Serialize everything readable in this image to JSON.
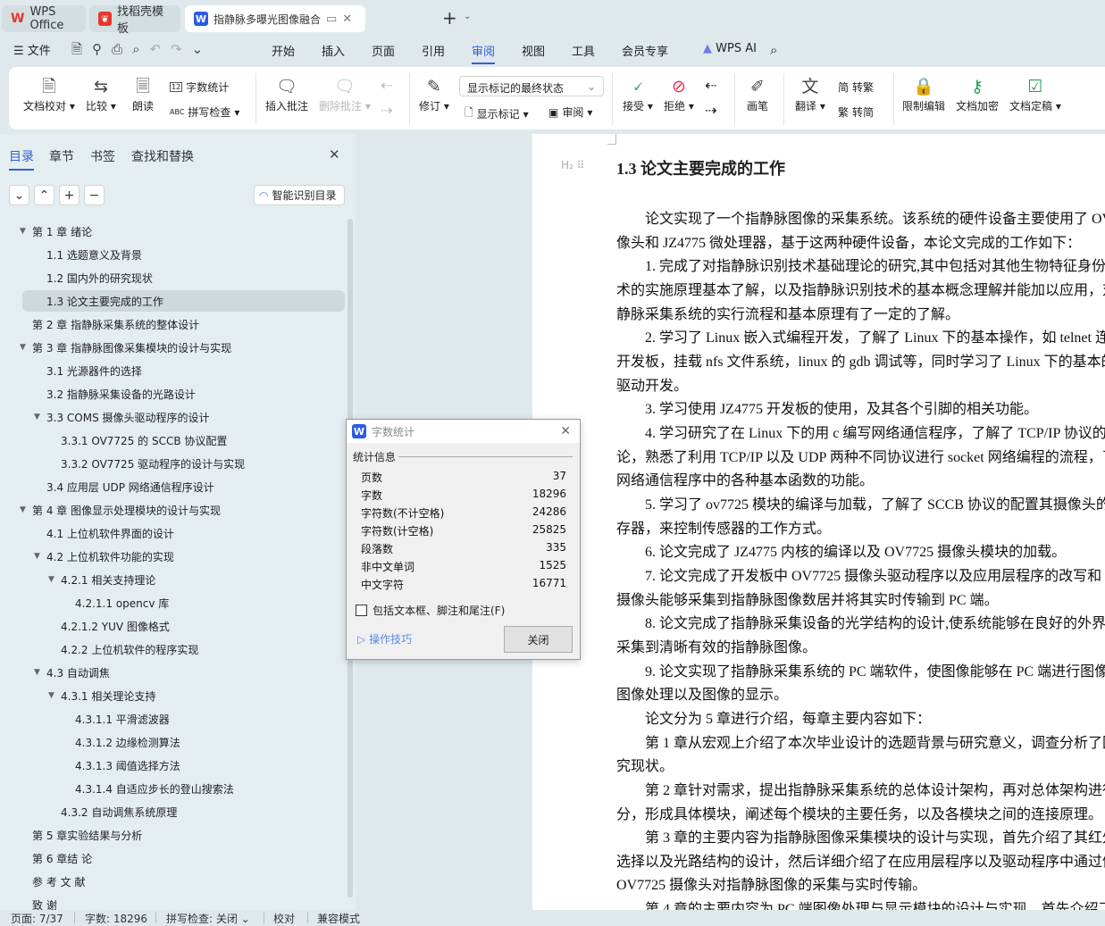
{
  "tabs": [
    {
      "label": "WPS Office",
      "icon": "wps-logo-icon"
    },
    {
      "label": "找稻壳模板",
      "icon": "docer-logo-icon"
    },
    {
      "label": "指静脉多曝光图像融合采集设计",
      "icon": "writer-logo-icon"
    }
  ],
  "menu": {
    "file": "文件",
    "items": [
      "开始",
      "插入",
      "页面",
      "引用",
      "审阅",
      "视图",
      "工具",
      "会员专享"
    ],
    "active": "审阅",
    "ai": "WPS AI"
  },
  "ribbon": {
    "proofread": "文档校对",
    "compare": "比较",
    "read_aloud": "朗读",
    "word_count": "字数统计",
    "spell_check": "拼写检查",
    "insert_comment": "插入批注",
    "delete_comment": "删除批注",
    "revise": "修订",
    "markup_select": "显示标记的最终状态",
    "show_markup": "显示标记",
    "review": "审阅",
    "accept": "接受",
    "reject": "拒绝",
    "pen": "画笔",
    "translate": "翻译",
    "to_traditional": "转繁",
    "to_simplified": "转简",
    "restrict_edit": "限制编辑",
    "encrypt": "文档加密",
    "finalize": "文档定稿"
  },
  "sidebar": {
    "tabs": [
      "目录",
      "章节",
      "书签",
      "查找和替换"
    ],
    "smart_toc": "智能识别目录",
    "outline": [
      {
        "label": "第 1 章  绪论",
        "level": 0,
        "expanded": true
      },
      {
        "label": "1.1  选题意义及背景",
        "level": 1
      },
      {
        "label": "1.2  国内外的研究现状",
        "level": 1
      },
      {
        "label": "1.3  论文主要完成的工作",
        "level": 1,
        "selected": true
      },
      {
        "label": "第 2 章  指静脉采集系统的整体设计",
        "level": 0
      },
      {
        "label": "第 3 章  指静脉图像采集模块的设计与实现",
        "level": 0,
        "expanded": true
      },
      {
        "label": "3.1  光源器件的选择",
        "level": 1
      },
      {
        "label": "3.2  指静脉采集设备的光路设计",
        "level": 1
      },
      {
        "label": "3.3 COMS 摄像头驱动程序的设计",
        "level": 1,
        "expanded": true
      },
      {
        "label": "3.3.1 OV7725 的 SCCB 协议配置",
        "level": 2
      },
      {
        "label": "3.3.2 OV7725 驱动程序的设计与实现",
        "level": 2
      },
      {
        "label": "3.4  应用层 UDP 网络通信程序设计",
        "level": 1
      },
      {
        "label": "第 4 章  图像显示处理模块的设计与实现",
        "level": 0,
        "expanded": true
      },
      {
        "label": "4.1  上位机软件界面的设计",
        "level": 1
      },
      {
        "label": "4.2  上位机软件功能的实现",
        "level": 1,
        "expanded": true
      },
      {
        "label": "4.2.1  相关支持理论",
        "level": 2,
        "expanded": true
      },
      {
        "label": "4.2.1.1  opencv 库",
        "level": 3
      },
      {
        "label": "4.2.1.2 YUV 图像格式",
        "level": 2
      },
      {
        "label": "4.2.2  上位机软件的程序实现",
        "level": 2
      },
      {
        "label": "4.3  自动调焦",
        "level": 1,
        "expanded": true
      },
      {
        "label": "4.3.1  相关理论支持",
        "level": 2,
        "expanded": true
      },
      {
        "label": "4.3.1.1  平滑滤波器",
        "level": 3
      },
      {
        "label": "4.3.1.2  边缘检测算法",
        "level": 3
      },
      {
        "label": "4.3.1.3  阈值选择方法",
        "level": 3
      },
      {
        "label": "4.3.1.4  自适应步长的登山搜索法",
        "level": 3
      },
      {
        "label": "4.3.2 自动调焦系统原理",
        "level": 2
      },
      {
        "label": "第 5 章实验结果与分析",
        "level": 0
      },
      {
        "label": "第 6 章结 论",
        "level": 0
      },
      {
        "label": "参 考 文 献",
        "level": 0
      },
      {
        "label": "致  谢",
        "level": 0
      }
    ]
  },
  "document": {
    "heading_marker": "H₂",
    "heading": "1.3  论文主要完成的工作",
    "lines": [
      {
        "t": "论文实现了一个指静脉图像的采集系统。该系统的硬件设备主要使用了 OV",
        "i": true
      },
      {
        "t": "像头和 JZ4775 微处理器，基于这两种硬件设备，本论文完成的工作如下："
      },
      {
        "t": "1. 完成了对指静脉识别技术基础理论的研究,其中包括对其他生物特征身份",
        "i": true
      },
      {
        "t": "术的实施原理基本了解，以及指静脉识别技术的基本概念理解并能加以应用，对"
      },
      {
        "t": "静脉采集系统的实行流程和基本原理有了一定的了解。"
      },
      {
        "t": "2. 学习了 Linux 嵌入式编程开发，了解了 Linux 下的基本操作，如 telnet 连",
        "i": true
      },
      {
        "t": "开发板，挂载 nfs 文件系统，linux 的 gdb 调试等，同时学习了 Linux 下的基本的"
      },
      {
        "t": "驱动开发。"
      },
      {
        "t": "3. 学习使用 JZ4775 开发板的使用，及其各个引脚的相关功能。",
        "i": true
      },
      {
        "t": "4. 学习研究了在 Linux 下的用 c 编写网络通信程序，了解了 TCP/IP 协议的",
        "i": true
      },
      {
        "t": "论，熟悉了利用 TCP/IP 以及 UDP 两种不同协议进行 socket 网络编程的流程，了"
      },
      {
        "t": "网络通信程序中的各种基本函数的功能。"
      },
      {
        "t": "5. 学习了 ov7725 模块的编译与加载，了解了 SCCB 协议的配置其摄像头的",
        "i": true
      },
      {
        "t": "存器，来控制传感器的工作方式。"
      },
      {
        "t": "6. 论文完成了 JZ4775 内核的编译以及 OV7725 摄像头模块的加载。",
        "i": true
      },
      {
        "t": "7. 论文完成了开发板中 OV7725 摄像头驱动程序以及应用层程序的改写和",
        "i": true
      },
      {
        "t": "摄像头能够采集到指静脉图像数居并将其实时传输到 PC 端。"
      },
      {
        "t": "8. 论文完成了指静脉采集设备的光学结构的设计,使系统能够在良好的外界",
        "i": true
      },
      {
        "t": "采集到清晰有效的指静脉图像。"
      },
      {
        "t": "9. 论文实现了指静脉采集系统的 PC 端软件，使图像能够在 PC 端进行图像",
        "i": true
      },
      {
        "t": "图像处理以及图像的显示。"
      },
      {
        "t": "论文分为 5 章进行介绍，每章主要内容如下：",
        "i": true
      },
      {
        "t": "第 1 章从宏观上介绍了本次毕业设计的选题背景与研究意义，调查分析了国",
        "i": true
      },
      {
        "t": "究现状。"
      },
      {
        "t": "第 2 章针对需求，提出指静脉采集系统的总体设计架构，再对总体架构进行",
        "i": true
      },
      {
        "t": "分，形成具体模块，阐述每个模块的主要任务，以及各模块之间的连接原理。"
      },
      {
        "t": "第 3 章的主要内容为指静脉图像采集模块的设计与实现，首先介绍了其红外",
        "i": true
      },
      {
        "t": "选择以及光路结构的设计，然后详细介绍了在应用层程序以及驱动程序中通过修"
      },
      {
        "t": "OV7725 摄像头对指静脉图像的采集与实时传输。"
      },
      {
        "t": "第 4 章的主要内容为 PC 端图像处理与显示模块的设计与实现，首先介绍了",
        "i": true
      }
    ]
  },
  "dialog": {
    "title": "字数统计",
    "section": "统计信息",
    "rows": [
      {
        "label": "页数",
        "value": "37"
      },
      {
        "label": "字数",
        "value": "18296"
      },
      {
        "label": "字符数(不计空格)",
        "value": "24286"
      },
      {
        "label": "字符数(计空格)",
        "value": "25825"
      },
      {
        "label": "段落数",
        "value": "335"
      },
      {
        "label": "非中文单词",
        "value": "1525"
      },
      {
        "label": "中文字符",
        "value": "16771"
      }
    ],
    "checkbox": "包括文本框、脚注和尾注(F)",
    "checkbox_checked": false,
    "tips": "操作技巧",
    "close": "关闭"
  },
  "status": {
    "page": "页面: 7/37",
    "words": "字数: 18296",
    "spell": "拼写检查: 关闭",
    "proof": "校对",
    "compat": "兼容模式"
  },
  "colors": {
    "accent": "#2f5fd8",
    "wps_red": "#e8362d",
    "writer_blue": "#2b5ce6"
  }
}
